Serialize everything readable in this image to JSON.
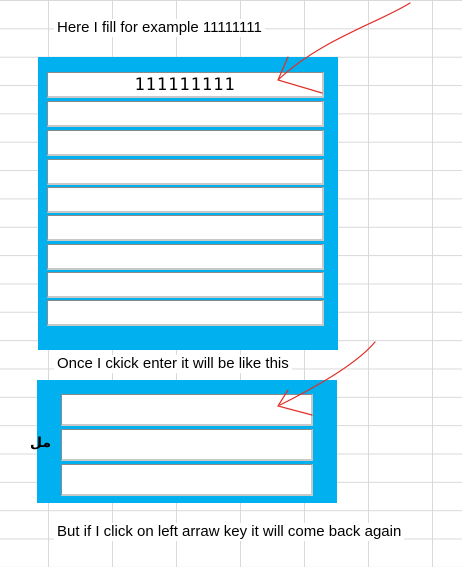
{
  "notes": {
    "top": "Here I fill for example 11111111",
    "middle": "Once I ckick enter it will be like this",
    "bottom": "But if I click on left arraw key it will come back again"
  },
  "form1": {
    "fields": [
      "111111111",
      "",
      "",
      "",
      "",
      "",
      "",
      "",
      ""
    ]
  },
  "form2": {
    "fields": [
      "",
      "",
      ""
    ],
    "label_cut": "مل"
  },
  "colors": {
    "panel": "#00b0ef",
    "annotation": "#e0302a"
  }
}
